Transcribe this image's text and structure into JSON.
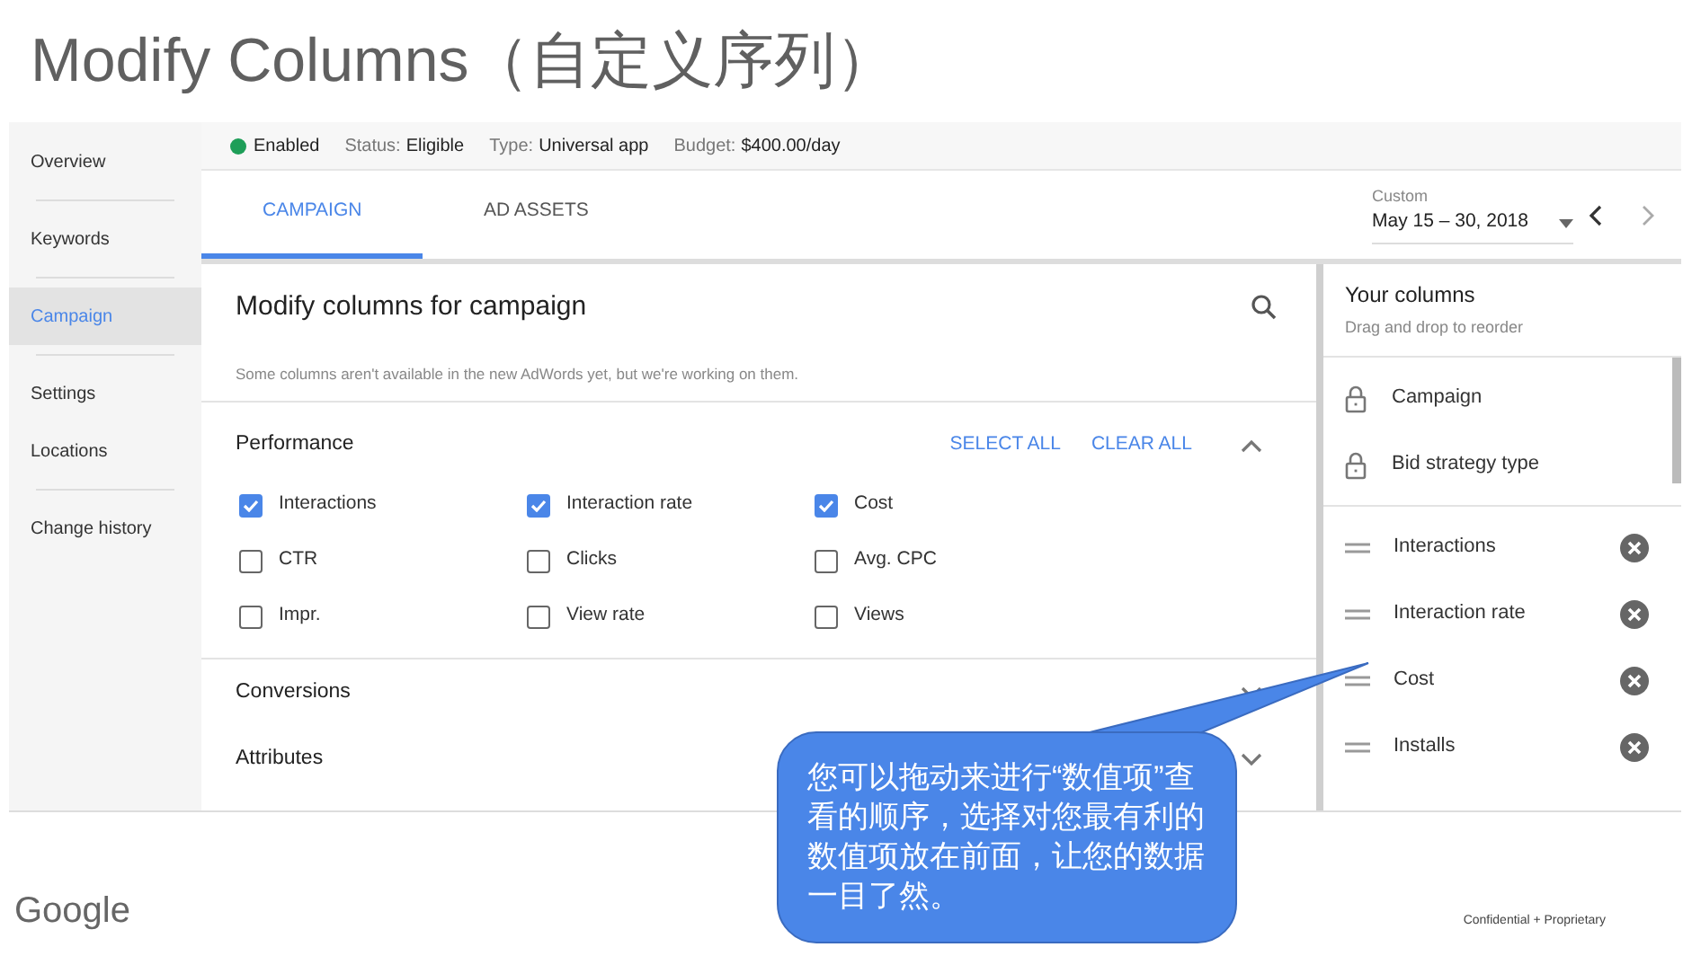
{
  "title": "Modify Columns（自定义序列）",
  "sidebar": {
    "items": [
      {
        "label": "Overview",
        "selected": false
      },
      {
        "label": "Keywords",
        "selected": false
      },
      {
        "label": "Campaign",
        "selected": true
      },
      {
        "label": "Settings",
        "selected": false
      },
      {
        "label": "Locations",
        "selected": false
      },
      {
        "label": "Change history",
        "selected": false
      }
    ]
  },
  "status_bar": {
    "state": "Enabled",
    "fields": [
      {
        "label": "Status:",
        "value": "Eligible"
      },
      {
        "label": "Type:",
        "value": "Universal app"
      },
      {
        "label": "Budget:",
        "value": "$400.00/day"
      }
    ]
  },
  "tabs": [
    {
      "label": "CAMPAIGN",
      "selected": true
    },
    {
      "label": "AD ASSETS",
      "selected": false
    }
  ],
  "date_range": {
    "label": "Custom",
    "value": "May 15 – 30, 2018"
  },
  "panel": {
    "title": "Modify columns for campaign",
    "note": "Some columns aren't available in the new AdWords yet, but we're working on them.",
    "sections": [
      {
        "name": "Performance",
        "expanded": true,
        "actions": [
          "SELECT ALL",
          "CLEAR ALL"
        ],
        "options": [
          {
            "label": "Interactions",
            "checked": true
          },
          {
            "label": "Interaction rate",
            "checked": true
          },
          {
            "label": "Cost",
            "checked": true
          },
          {
            "label": "CTR",
            "checked": false
          },
          {
            "label": "Clicks",
            "checked": false
          },
          {
            "label": "Avg. CPC",
            "checked": false
          },
          {
            "label": "Impr.",
            "checked": false
          },
          {
            "label": "View rate",
            "checked": false
          },
          {
            "label": "Views",
            "checked": false
          }
        ]
      },
      {
        "name": "Conversions",
        "expanded": false
      },
      {
        "name": "Attributes",
        "expanded": false
      }
    ]
  },
  "your_columns": {
    "title": "Your columns",
    "subtitle": "Drag and drop to reorder",
    "items": [
      {
        "label": "Campaign",
        "kind": "locked"
      },
      {
        "label": "Bid strategy type",
        "kind": "locked"
      },
      {
        "label": "Interactions",
        "kind": "removable"
      },
      {
        "label": "Interaction rate",
        "kind": "removable"
      },
      {
        "label": "Cost",
        "kind": "removable"
      },
      {
        "label": "Installs",
        "kind": "removable"
      }
    ]
  },
  "callout": "您可以拖动来进行“数值项”查看的顺序，选择对您最有利的数值项放在前面，让您的数据一目了然。",
  "footer": {
    "logo": "Google",
    "note": "Confidential + Proprietary"
  }
}
